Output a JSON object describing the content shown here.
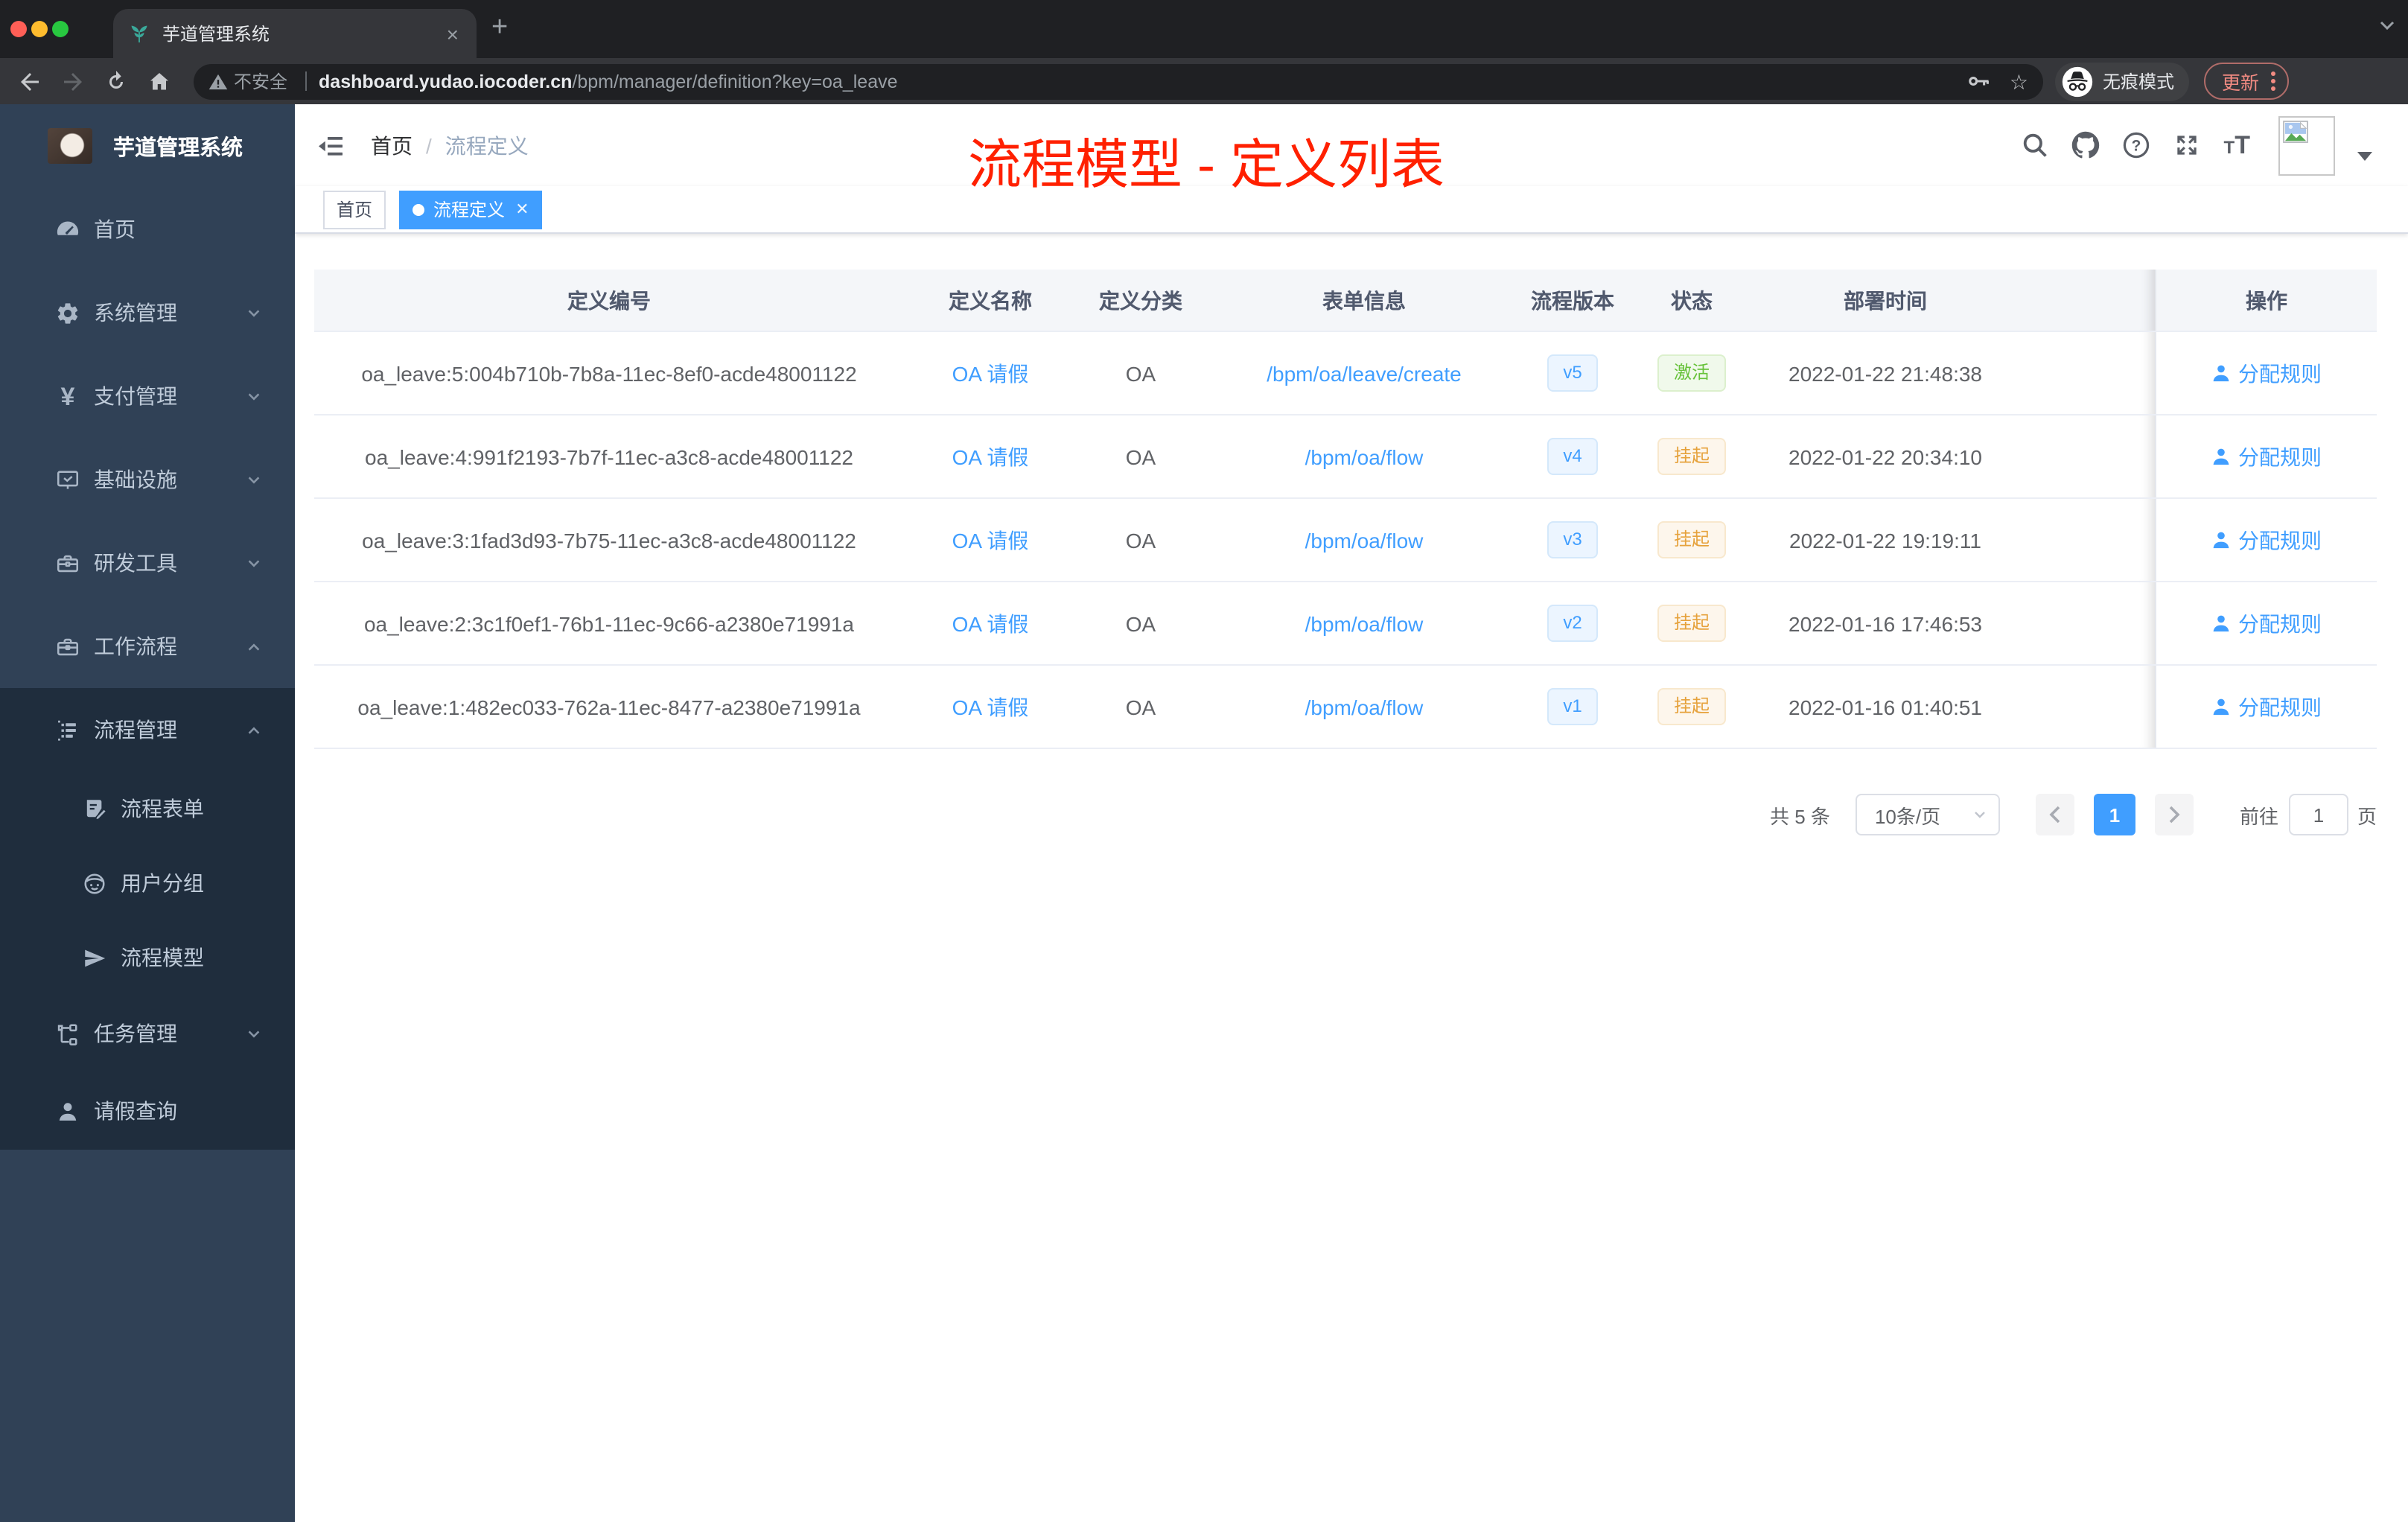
{
  "browser": {
    "tab": {
      "title": "芋道管理系统",
      "close_label": "×",
      "new_tab_label": "+"
    },
    "toolbar": {
      "security_label": "不安全",
      "url_domain": "dashboard.yudao.iocoder.cn",
      "url_path": "/bpm/manager/definition?key=oa_leave",
      "incognito_label": "无痕模式",
      "update_label": "更新"
    },
    "traffic_lights": [
      "#ff5f57",
      "#febc2e",
      "#28c840"
    ]
  },
  "sidebar": {
    "app_title": "芋道管理系统",
    "items": [
      {
        "label": "首页",
        "icon": "dashboard-icon"
      },
      {
        "label": "系统管理",
        "icon": "gear-icon",
        "arrow": "down"
      },
      {
        "label": "支付管理",
        "icon": "yen-icon",
        "arrow": "down"
      },
      {
        "label": "基础设施",
        "icon": "monitor-icon",
        "arrow": "down"
      },
      {
        "label": "研发工具",
        "icon": "toolbox-icon",
        "arrow": "down"
      },
      {
        "label": "工作流程",
        "icon": "briefcase-icon",
        "arrow": "up"
      },
      {
        "label": "流程管理",
        "icon": "list-icon",
        "arrow": "up"
      },
      {
        "label": "流程表单",
        "icon": "form-icon"
      },
      {
        "label": "用户分组",
        "icon": "user-group-icon"
      },
      {
        "label": "流程模型",
        "icon": "paper-plane-icon"
      },
      {
        "label": "任务管理",
        "icon": "tree-icon",
        "arrow": "down"
      },
      {
        "label": "请假查询",
        "icon": "person-icon"
      }
    ]
  },
  "navbar": {
    "breadcrumb": {
      "home": "首页",
      "separator": "/",
      "current": "流程定义"
    }
  },
  "annotation": {
    "text": "流程模型 - 定义列表",
    "color": "#ff2000"
  },
  "tags": {
    "items": [
      {
        "label": "首页",
        "active": false
      },
      {
        "label": "流程定义",
        "active": true
      }
    ]
  },
  "table": {
    "columns": [
      "定义编号",
      "定义名称",
      "定义分类",
      "表单信息",
      "流程版本",
      "状态",
      "部署时间",
      "操作"
    ],
    "rows": [
      {
        "id": "oa_leave:5:004b710b-7b8a-11ec-8ef0-acde48001122",
        "name": "OA 请假",
        "category": "OA",
        "form": "/bpm/oa/leave/create",
        "version": "v5",
        "status": "激活",
        "status_type": "success",
        "deployed_at": "2022-01-22 21:48:38",
        "action": "分配规则"
      },
      {
        "id": "oa_leave:4:991f2193-7b7f-11ec-a3c8-acde48001122",
        "name": "OA 请假",
        "category": "OA",
        "form": "/bpm/oa/flow",
        "version": "v4",
        "status": "挂起",
        "status_type": "warning",
        "deployed_at": "2022-01-22 20:34:10",
        "action": "分配规则"
      },
      {
        "id": "oa_leave:3:1fad3d93-7b75-11ec-a3c8-acde48001122",
        "name": "OA 请假",
        "category": "OA",
        "form": "/bpm/oa/flow",
        "version": "v3",
        "status": "挂起",
        "status_type": "warning",
        "deployed_at": "2022-01-22 19:19:11",
        "action": "分配规则"
      },
      {
        "id": "oa_leave:2:3c1f0ef1-76b1-11ec-9c66-a2380e71991a",
        "name": "OA 请假",
        "category": "OA",
        "form": "/bpm/oa/flow",
        "version": "v2",
        "status": "挂起",
        "status_type": "warning",
        "deployed_at": "2022-01-16 17:46:53",
        "action": "分配规则"
      },
      {
        "id": "oa_leave:1:482ec033-762a-11ec-8477-a2380e71991a",
        "name": "OA 请假",
        "category": "OA",
        "form": "/bpm/oa/flow",
        "version": "v1",
        "status": "挂起",
        "status_type": "warning",
        "deployed_at": "2022-01-16 01:40:51",
        "action": "分配规则"
      }
    ]
  },
  "pagination": {
    "total": "共 5 条",
    "page_size": "10条/页",
    "current_page": "1",
    "goto_label": "前往",
    "goto_value": "1",
    "page_unit": "页"
  },
  "colors": {
    "primary": "#409eff",
    "success": "#67c23a",
    "warning": "#e6a23c",
    "sidebar_bg": "#304156",
    "submenu_bg": "#1f2d3d",
    "annotation_red": "#ff2000"
  }
}
